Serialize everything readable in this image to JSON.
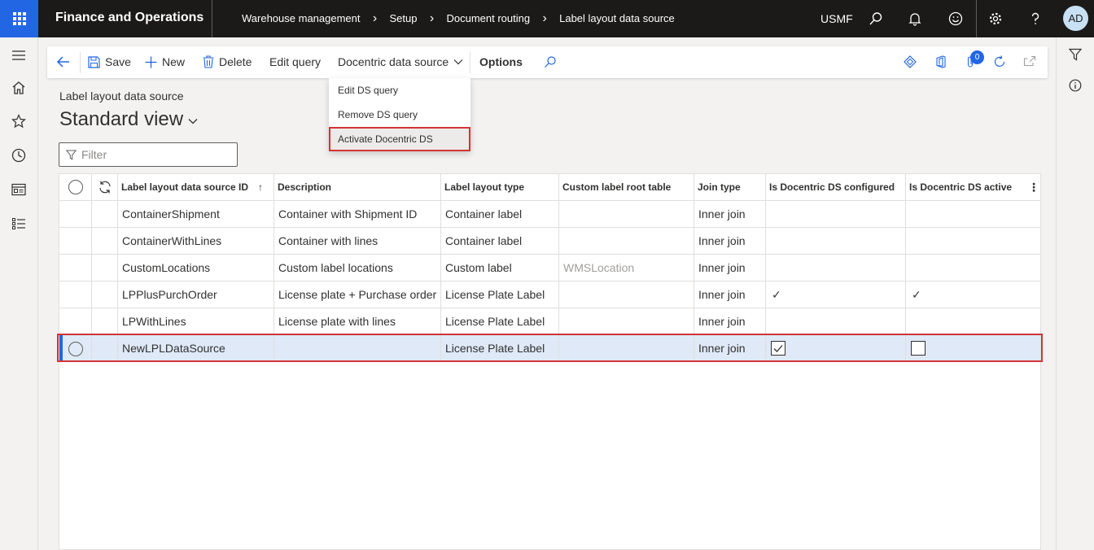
{
  "topbar": {
    "app_title": "Finance and Operations",
    "breadcrumbs": [
      "Warehouse management",
      "Setup",
      "Document routing",
      "Label layout data source"
    ],
    "company": "USMF",
    "avatar_initials": "AD"
  },
  "actions": {
    "save": "Save",
    "new": "New",
    "delete": "Delete",
    "edit_query": "Edit query",
    "docentric_ds": "Docentric data source",
    "options": "Options",
    "attachments_count": "0"
  },
  "dropdown": {
    "items": [
      "Edit DS query",
      "Remove DS query",
      "Activate Docentric DS"
    ],
    "highlighted": "Activate Docentric DS"
  },
  "page": {
    "caption": "Label layout data source",
    "view_title": "Standard view",
    "filter_placeholder": "Filter"
  },
  "grid": {
    "columns": [
      "Label layout data source ID",
      "Description",
      "Label layout type",
      "Custom label root table",
      "Join type",
      "Is Docentric DS configured",
      "Is Docentric DS active"
    ],
    "rows": [
      {
        "id": "ContainerShipment",
        "description": "Container with Shipment ID",
        "type": "Container label",
        "root_table": "",
        "join": "Inner join",
        "configured": "",
        "active": ""
      },
      {
        "id": "ContainerWithLines",
        "description": "Container with lines",
        "type": "Container label",
        "root_table": "",
        "join": "Inner join",
        "configured": "",
        "active": ""
      },
      {
        "id": "CustomLocations",
        "description": "Custom label locations",
        "type": "Custom label",
        "root_table": "WMSLocation",
        "join": "Inner join",
        "configured": "",
        "active": ""
      },
      {
        "id": "LPPlusPurchOrder",
        "description": "License plate + Purchase order",
        "type": "License Plate Label",
        "root_table": "",
        "join": "Inner join",
        "configured": "✓",
        "active": "✓"
      },
      {
        "id": "LPWithLines",
        "description": "License plate with lines",
        "type": "License Plate Label",
        "root_table": "",
        "join": "Inner join",
        "configured": "",
        "active": ""
      },
      {
        "id": "NewLPLDataSource",
        "description": "",
        "type": "License Plate Label",
        "root_table": "",
        "join": "Inner join",
        "configured_checked": true,
        "active_checked": false
      }
    ]
  },
  "colors": {
    "topbar": "#1b1a19",
    "waffle": "#2266e3",
    "selected_row": "#dfe9f7",
    "highlight_border": "#d13438"
  }
}
